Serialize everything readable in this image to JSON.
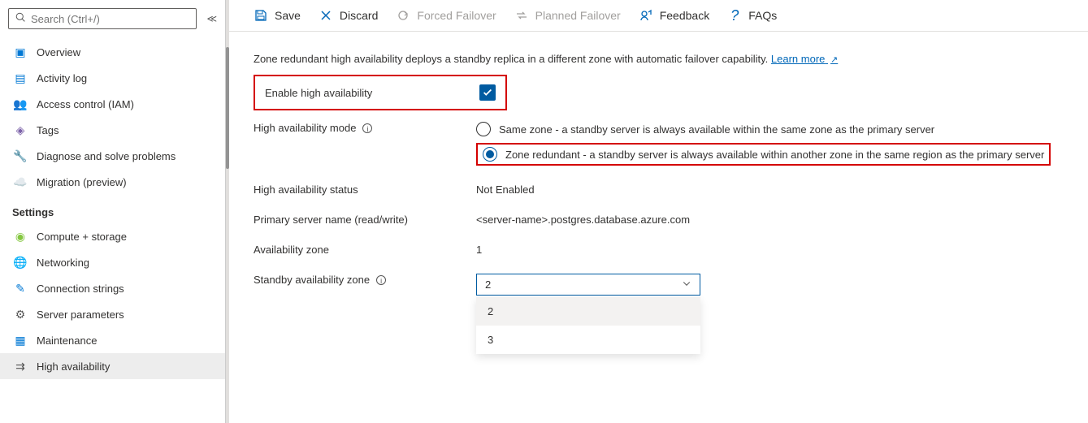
{
  "search": {
    "placeholder": "Search (Ctrl+/)"
  },
  "sidebar": {
    "items": [
      {
        "icon": "overview-icon",
        "glyph": "▣",
        "color": "#0078d4",
        "label": "Overview"
      },
      {
        "icon": "activity-log-icon",
        "glyph": "▤",
        "color": "#0078d4",
        "label": "Activity log"
      },
      {
        "icon": "access-control-icon",
        "glyph": "👥",
        "color": "#0078d4",
        "label": "Access control (IAM)"
      },
      {
        "icon": "tags-icon",
        "glyph": "◈",
        "color": "#7b61a8",
        "label": "Tags"
      },
      {
        "icon": "diagnose-icon",
        "glyph": "🔧",
        "color": "#555",
        "label": "Diagnose and solve problems"
      },
      {
        "icon": "migration-icon",
        "glyph": "☁️",
        "color": "#0078d4",
        "label": "Migration (preview)"
      }
    ],
    "section": "Settings",
    "settings": [
      {
        "icon": "compute-icon",
        "glyph": "◉",
        "color": "#84c740",
        "label": "Compute + storage"
      },
      {
        "icon": "networking-icon",
        "glyph": "🌐",
        "color": "#0078d4",
        "label": "Networking"
      },
      {
        "icon": "connection-strings-icon",
        "glyph": "✎",
        "color": "#0078d4",
        "label": "Connection strings"
      },
      {
        "icon": "server-parameters-icon",
        "glyph": "⚙",
        "color": "#555",
        "label": "Server parameters"
      },
      {
        "icon": "maintenance-icon",
        "glyph": "▦",
        "color": "#0078d4",
        "label": "Maintenance"
      },
      {
        "icon": "high-availability-icon",
        "glyph": "⇉",
        "color": "#555",
        "label": "High availability",
        "active": true
      }
    ]
  },
  "toolbar": {
    "save": "Save",
    "discard": "Discard",
    "forced_failover": "Forced Failover",
    "planned_failover": "Planned Failover",
    "feedback": "Feedback",
    "faqs": "FAQs"
  },
  "content": {
    "description": "Zone redundant high availability deploys a standby replica in a different zone with automatic failover capability.",
    "learn_more": "Learn more",
    "enable_label": "Enable high availability",
    "mode_label": "High availability mode",
    "mode_options": {
      "same_zone": "Same zone - a standby server is always available within the same zone as the primary server",
      "zone_redundant": "Zone redundant - a standby server is always available within another zone in the same region as the primary server"
    },
    "status_label": "High availability status",
    "status_value": "Not Enabled",
    "primary_label": "Primary server name (read/write)",
    "primary_value": "<server-name>.postgres.database.azure.com",
    "az_label": "Availability zone",
    "az_value": "1",
    "standby_label": "Standby availability zone",
    "standby_value": "2",
    "standby_options": [
      "2",
      "3"
    ]
  }
}
